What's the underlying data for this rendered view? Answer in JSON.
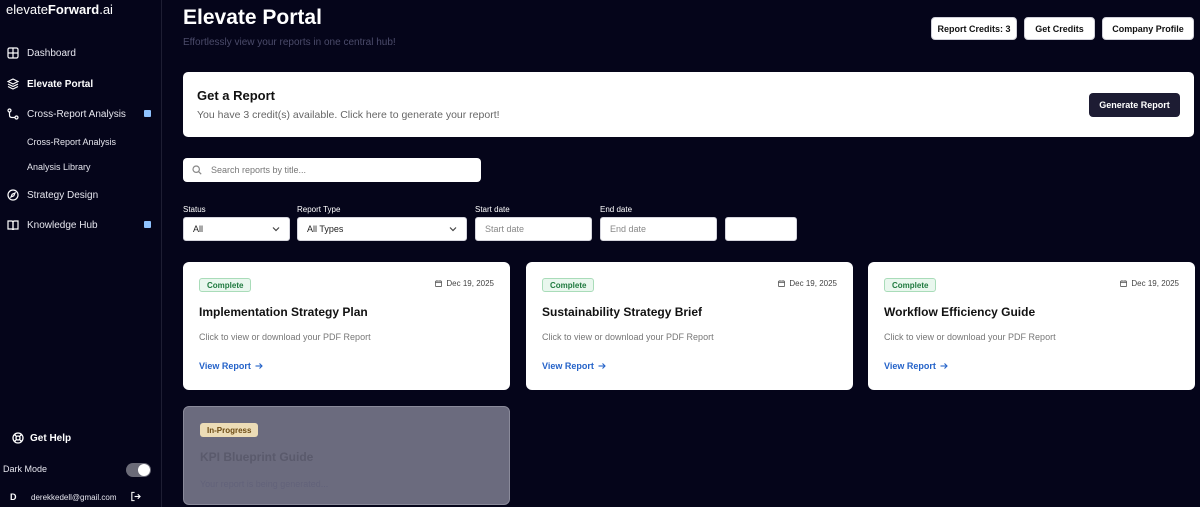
{
  "brand": {
    "prefix": "elevate",
    "bold": "Forward",
    "suffix": ".ai"
  },
  "sidebar": {
    "items": [
      {
        "label": "Dashboard",
        "icon": "grid-icon"
      },
      {
        "label": "Elevate Portal",
        "icon": "layers-icon"
      },
      {
        "label": "Cross-Report Analysis",
        "icon": "branch-icon"
      },
      {
        "label": "Strategy Design",
        "icon": "compass-icon"
      },
      {
        "label": "Knowledge Hub",
        "icon": "book-icon"
      }
    ],
    "sub_items": [
      "Cross-Report Analysis",
      "Analysis Library"
    ],
    "get_help": "Get Help",
    "dark_mode": "Dark Mode",
    "user_initial": "D",
    "user_email": "derekkedell@gmail.com"
  },
  "header": {
    "title": "Elevate Portal",
    "subtitle": "Effortlessly view your reports in one central hub!",
    "buttons": {
      "credits": "Report Credits: 3",
      "get_credits": "Get Credits",
      "profile": "Company Profile"
    }
  },
  "get_report": {
    "title": "Get a Report",
    "text": "You have 3 credit(s) available. Click here to generate your report!",
    "button": "Generate Report"
  },
  "search": {
    "placeholder": "Search reports by title..."
  },
  "filters": {
    "status_label": "Status",
    "status_value": "All",
    "type_label": "Report Type",
    "type_value": "All Types",
    "start_label": "Start date",
    "start_placeholder": "Start date",
    "end_label": "End date",
    "end_placeholder": "End date"
  },
  "cards": [
    {
      "status": "Complete",
      "date": "Dec 19, 2025",
      "title": "Implementation Strategy Plan",
      "desc": "Click to view or download your PDF Report",
      "link": "View Report"
    },
    {
      "status": "Complete",
      "date": "Dec 19, 2025",
      "title": "Sustainability Strategy Brief",
      "desc": "Click to view or download your PDF Report",
      "link": "View Report"
    },
    {
      "status": "Complete",
      "date": "Dec 19, 2025",
      "title": "Workflow Efficiency Guide",
      "desc": "Click to view or download your PDF Report",
      "link": "View Report"
    },
    {
      "status": "In-Progress",
      "title": "KPI Blueprint Guide",
      "desc": "Your report is being generated..."
    }
  ],
  "colors": {
    "background": "#05051a",
    "primary_button": "#1d1c33",
    "link": "#2563c9",
    "badge_complete": "#1f7a3f",
    "badge_progress": "#ecdcb6"
  }
}
